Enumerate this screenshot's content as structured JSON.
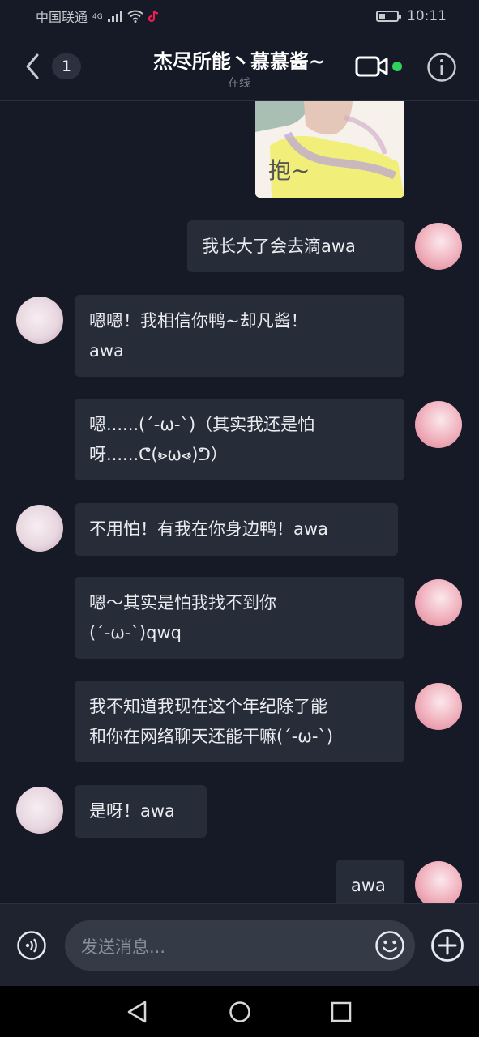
{
  "status_bar": {
    "carrier": "中国联通",
    "network": "4G",
    "time": "10:11",
    "battery_level": 0.35
  },
  "header": {
    "back_label": "",
    "unread_count": "1",
    "title": "杰尽所能丶慕慕酱~",
    "subtitle": "在线",
    "online_color": "#2fd35c"
  },
  "sticker": {
    "caption": "抱~"
  },
  "messages": [
    {
      "side": "self",
      "lines": [
        "我长大了会去滴awa"
      ]
    },
    {
      "side": "peer",
      "lines": [
        "嗯嗯！我相信你鸭~却凡酱！",
        "awa"
      ]
    },
    {
      "side": "self",
      "lines": [
        "嗯......(´-ω-`)（其实我还是怕",
        "呀......ᕦ(⩺ω⩹)ᕤ）"
      ]
    },
    {
      "side": "peer",
      "lines": [
        "不用怕！有我在你身边鸭！awa"
      ]
    },
    {
      "side": "self",
      "lines": [
        "嗯～其实是怕我找不到你",
        "(´-ω-`)qwq"
      ]
    },
    {
      "side": "self",
      "lines": [
        "我不知道我现在这个年纪除了能",
        "和你在网络聊天还能干嘛(´-ω-`)"
      ]
    },
    {
      "side": "peer",
      "lines": [
        "是呀！awa"
      ]
    },
    {
      "side": "self",
      "lines": [
        "awa"
      ]
    }
  ],
  "input": {
    "placeholder": "发送消息..."
  },
  "colors": {
    "background": "#161a27",
    "bubble": "#272c39",
    "input_field": "#353a47"
  },
  "icons": [
    "back-arrow-icon",
    "video-call-icon",
    "info-icon",
    "voice-icon",
    "emoji-icon",
    "plus-icon",
    "nav-back-icon",
    "nav-home-icon",
    "nav-recent-icon"
  ]
}
